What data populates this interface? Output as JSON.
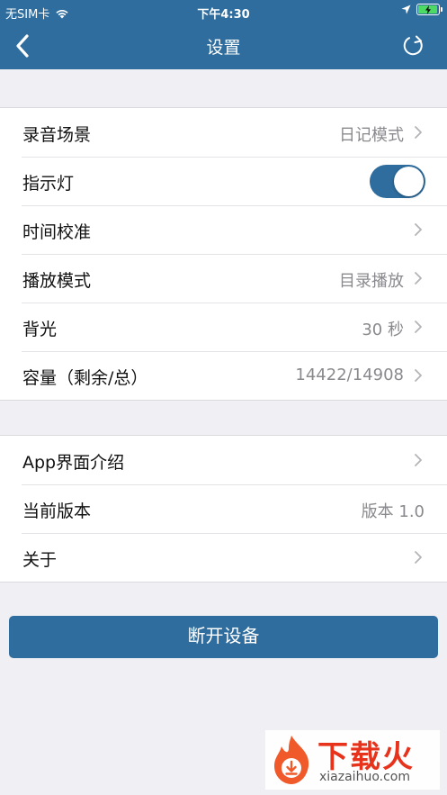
{
  "status_bar": {
    "carrier": "无SIM卡",
    "time": "下午4:30",
    "icons": [
      "wifi-icon",
      "location-arrow-icon",
      "battery-charging-icon"
    ]
  },
  "nav": {
    "title": "设置",
    "back_icon": "chevron-left-icon",
    "refresh_icon": "refresh-icon"
  },
  "settings_group_1": [
    {
      "label": "录音场景",
      "value": "日记模式",
      "chevron": true
    },
    {
      "label": "指示灯",
      "toggle": true,
      "toggle_on": true
    },
    {
      "label": "时间校准",
      "value": "",
      "chevron": true
    },
    {
      "label": "播放模式",
      "value": "目录播放",
      "chevron": true
    },
    {
      "label": "背光",
      "value": "30 秒",
      "chevron": true
    },
    {
      "label": "容量（剩余/总）",
      "value": "14422/14908",
      "chevron": true
    }
  ],
  "settings_group_2": [
    {
      "label": "App界面介绍",
      "value": "",
      "chevron": true
    },
    {
      "label": "当前版本",
      "value": "版本 1.0",
      "chevron": false
    },
    {
      "label": "关于",
      "value": "",
      "chevron": true
    }
  ],
  "disconnect_button": {
    "label": "断开设备"
  },
  "watermark": {
    "brand": "下载火",
    "domain": "xiazaihuo.com"
  },
  "colors": {
    "accent": "#2e6d9e",
    "background": "#efeff4",
    "secondary_text": "#8a8a8e",
    "watermark_red": "#e8331c"
  }
}
